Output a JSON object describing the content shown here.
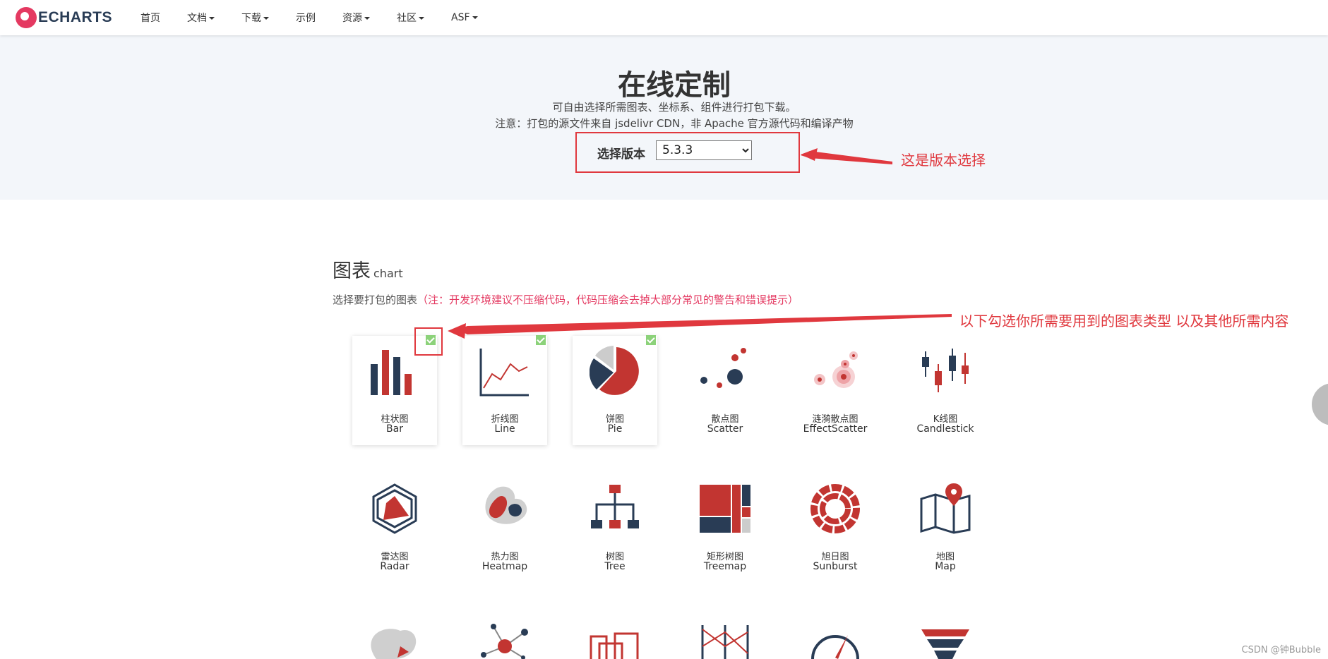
{
  "nav": {
    "brand": "ECHARTS",
    "items": [
      {
        "label": "首页",
        "dropdown": false
      },
      {
        "label": "文档",
        "dropdown": true
      },
      {
        "label": "下载",
        "dropdown": true
      },
      {
        "label": "示例",
        "dropdown": false
      },
      {
        "label": "资源",
        "dropdown": true
      },
      {
        "label": "社区",
        "dropdown": true
      },
      {
        "label": "ASF",
        "dropdown": true
      }
    ]
  },
  "header": {
    "title": "在线定制",
    "desc1": "可自由选择所需图表、坐标系、组件进行打包下载。",
    "desc2": "注意：打包的源文件来自 jsdelivr CDN，非 Apache 官方源代码和编译产物",
    "version_label": "选择版本",
    "version_value": "5.3.3"
  },
  "annotations": {
    "version": "这是版本选择",
    "charts": "以下勾选你所需要用到的图表类型  以及其他所需内容"
  },
  "section": {
    "title": "图表",
    "title_en": "chart",
    "desc": "选择要打包的图表",
    "note": "（注：开发环境建议不压缩代码，代码压缩会去掉大部分常见的警告和错误提示）"
  },
  "charts": [
    {
      "zh": "柱状图",
      "en": "Bar",
      "icon": "bar-chart-icon",
      "selected": true
    },
    {
      "zh": "折线图",
      "en": "Line",
      "icon": "line-chart-icon",
      "selected": true
    },
    {
      "zh": "饼图",
      "en": "Pie",
      "icon": "pie-chart-icon",
      "selected": true
    },
    {
      "zh": "散点图",
      "en": "Scatter",
      "icon": "scatter-chart-icon",
      "selected": false
    },
    {
      "zh": "涟漪散点图",
      "en": "EffectScatter",
      "icon": "effect-scatter-icon",
      "selected": false
    },
    {
      "zh": "K线图",
      "en": "Candlestick",
      "icon": "candlestick-icon",
      "selected": false
    },
    {
      "zh": "雷达图",
      "en": "Radar",
      "icon": "radar-chart-icon",
      "selected": false
    },
    {
      "zh": "热力图",
      "en": "Heatmap",
      "icon": "heatmap-icon",
      "selected": false
    },
    {
      "zh": "树图",
      "en": "Tree",
      "icon": "tree-chart-icon",
      "selected": false
    },
    {
      "zh": "矩形树图",
      "en": "Treemap",
      "icon": "treemap-icon",
      "selected": false
    },
    {
      "zh": "旭日图",
      "en": "Sunburst",
      "icon": "sunburst-icon",
      "selected": false
    },
    {
      "zh": "地图",
      "en": "Map",
      "icon": "map-icon",
      "selected": false
    }
  ],
  "colors": {
    "dark": "#293c55",
    "red": "#c23531",
    "accent": "#e43961",
    "annotation": "#e0383e",
    "check": "#8cd27a"
  },
  "watermark": "CSDN @钟Bubble"
}
